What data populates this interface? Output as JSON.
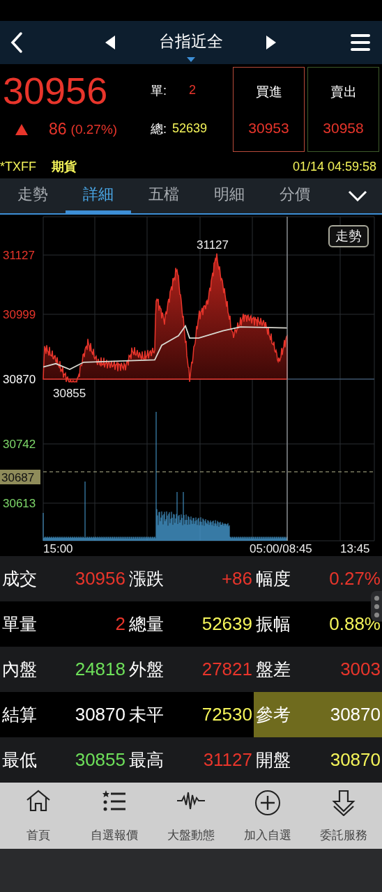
{
  "header": {
    "title": "台指近全"
  },
  "quote": {
    "price": "30956",
    "change": "86",
    "change_pct": "(0.27%)",
    "single_label": "單:",
    "single": "2",
    "total_label": "總:",
    "total": "52639"
  },
  "buy": {
    "label": "買進",
    "price": "30953"
  },
  "sell": {
    "label": "賣出",
    "price": "30958"
  },
  "info": {
    "symbol": "*TXFF",
    "market": "期貨",
    "datetime": "01/14 04:59:58"
  },
  "tabs": [
    {
      "label": "走勢",
      "selected": false
    },
    {
      "label": "詳細",
      "selected": true
    },
    {
      "label": "五檔",
      "selected": false
    },
    {
      "label": "明細",
      "selected": false
    },
    {
      "label": "分價",
      "selected": false
    }
  ],
  "chart": {
    "trend_button": "走勢",
    "high_label": "31127",
    "low_label": "30855",
    "y_labels": [
      {
        "text": "31127",
        "color": "#e8352b"
      },
      {
        "text": "30999",
        "color": "#e8352b"
      },
      {
        "text": "30870",
        "color": "#ffffff"
      },
      {
        "text": "30742",
        "color": "#7ed86a"
      },
      {
        "text": "30613",
        "color": "#7ed86a"
      }
    ],
    "cursor_label": "30687",
    "x_labels": [
      "15:00",
      "05:00/08:45",
      "13:45"
    ]
  },
  "stats": [
    [
      {
        "label": "成交",
        "value": "30956",
        "color": "#e8352b",
        "highlighted": false
      },
      {
        "label": "漲跌",
        "value": "+86",
        "color": "#e8352b",
        "highlighted": false
      },
      {
        "label": "幅度",
        "value": "0.27%",
        "color": "#e8352b",
        "highlighted": false
      }
    ],
    [
      {
        "label": "單量",
        "value": "2",
        "color": "#e8352b",
        "highlighted": false
      },
      {
        "label": "總量",
        "value": "52639",
        "color": "#f5f55a",
        "highlighted": false
      },
      {
        "label": "振幅",
        "value": "0.88%",
        "color": "#f5f55a",
        "highlighted": false
      }
    ],
    [
      {
        "label": "內盤",
        "value": "24818",
        "color": "#6ee05a",
        "highlighted": false
      },
      {
        "label": "外盤",
        "value": "27821",
        "color": "#e8352b",
        "highlighted": false
      },
      {
        "label": "盤差",
        "value": "3003",
        "color": "#e8352b",
        "highlighted": false
      }
    ],
    [
      {
        "label": "結算",
        "value": "30870",
        "color": "#ffffff",
        "highlighted": false
      },
      {
        "label": "未平",
        "value": "72530",
        "color": "#f5f55a",
        "highlighted": false
      },
      {
        "label": "參考",
        "value": "30870",
        "color": "#ffffff",
        "highlighted": true
      }
    ],
    [
      {
        "label": "最低",
        "value": "30855",
        "color": "#6ee05a",
        "highlighted": false
      },
      {
        "label": "最高",
        "value": "31127",
        "color": "#e8352b",
        "highlighted": false
      },
      {
        "label": "開盤",
        "value": "30870",
        "color": "#f5f55a",
        "highlighted": false
      }
    ]
  ],
  "nav": [
    {
      "label": "首頁"
    },
    {
      "label": "自選報價"
    },
    {
      "label": "大盤動態"
    },
    {
      "label": "加入自選"
    },
    {
      "label": "委託服務"
    }
  ]
}
